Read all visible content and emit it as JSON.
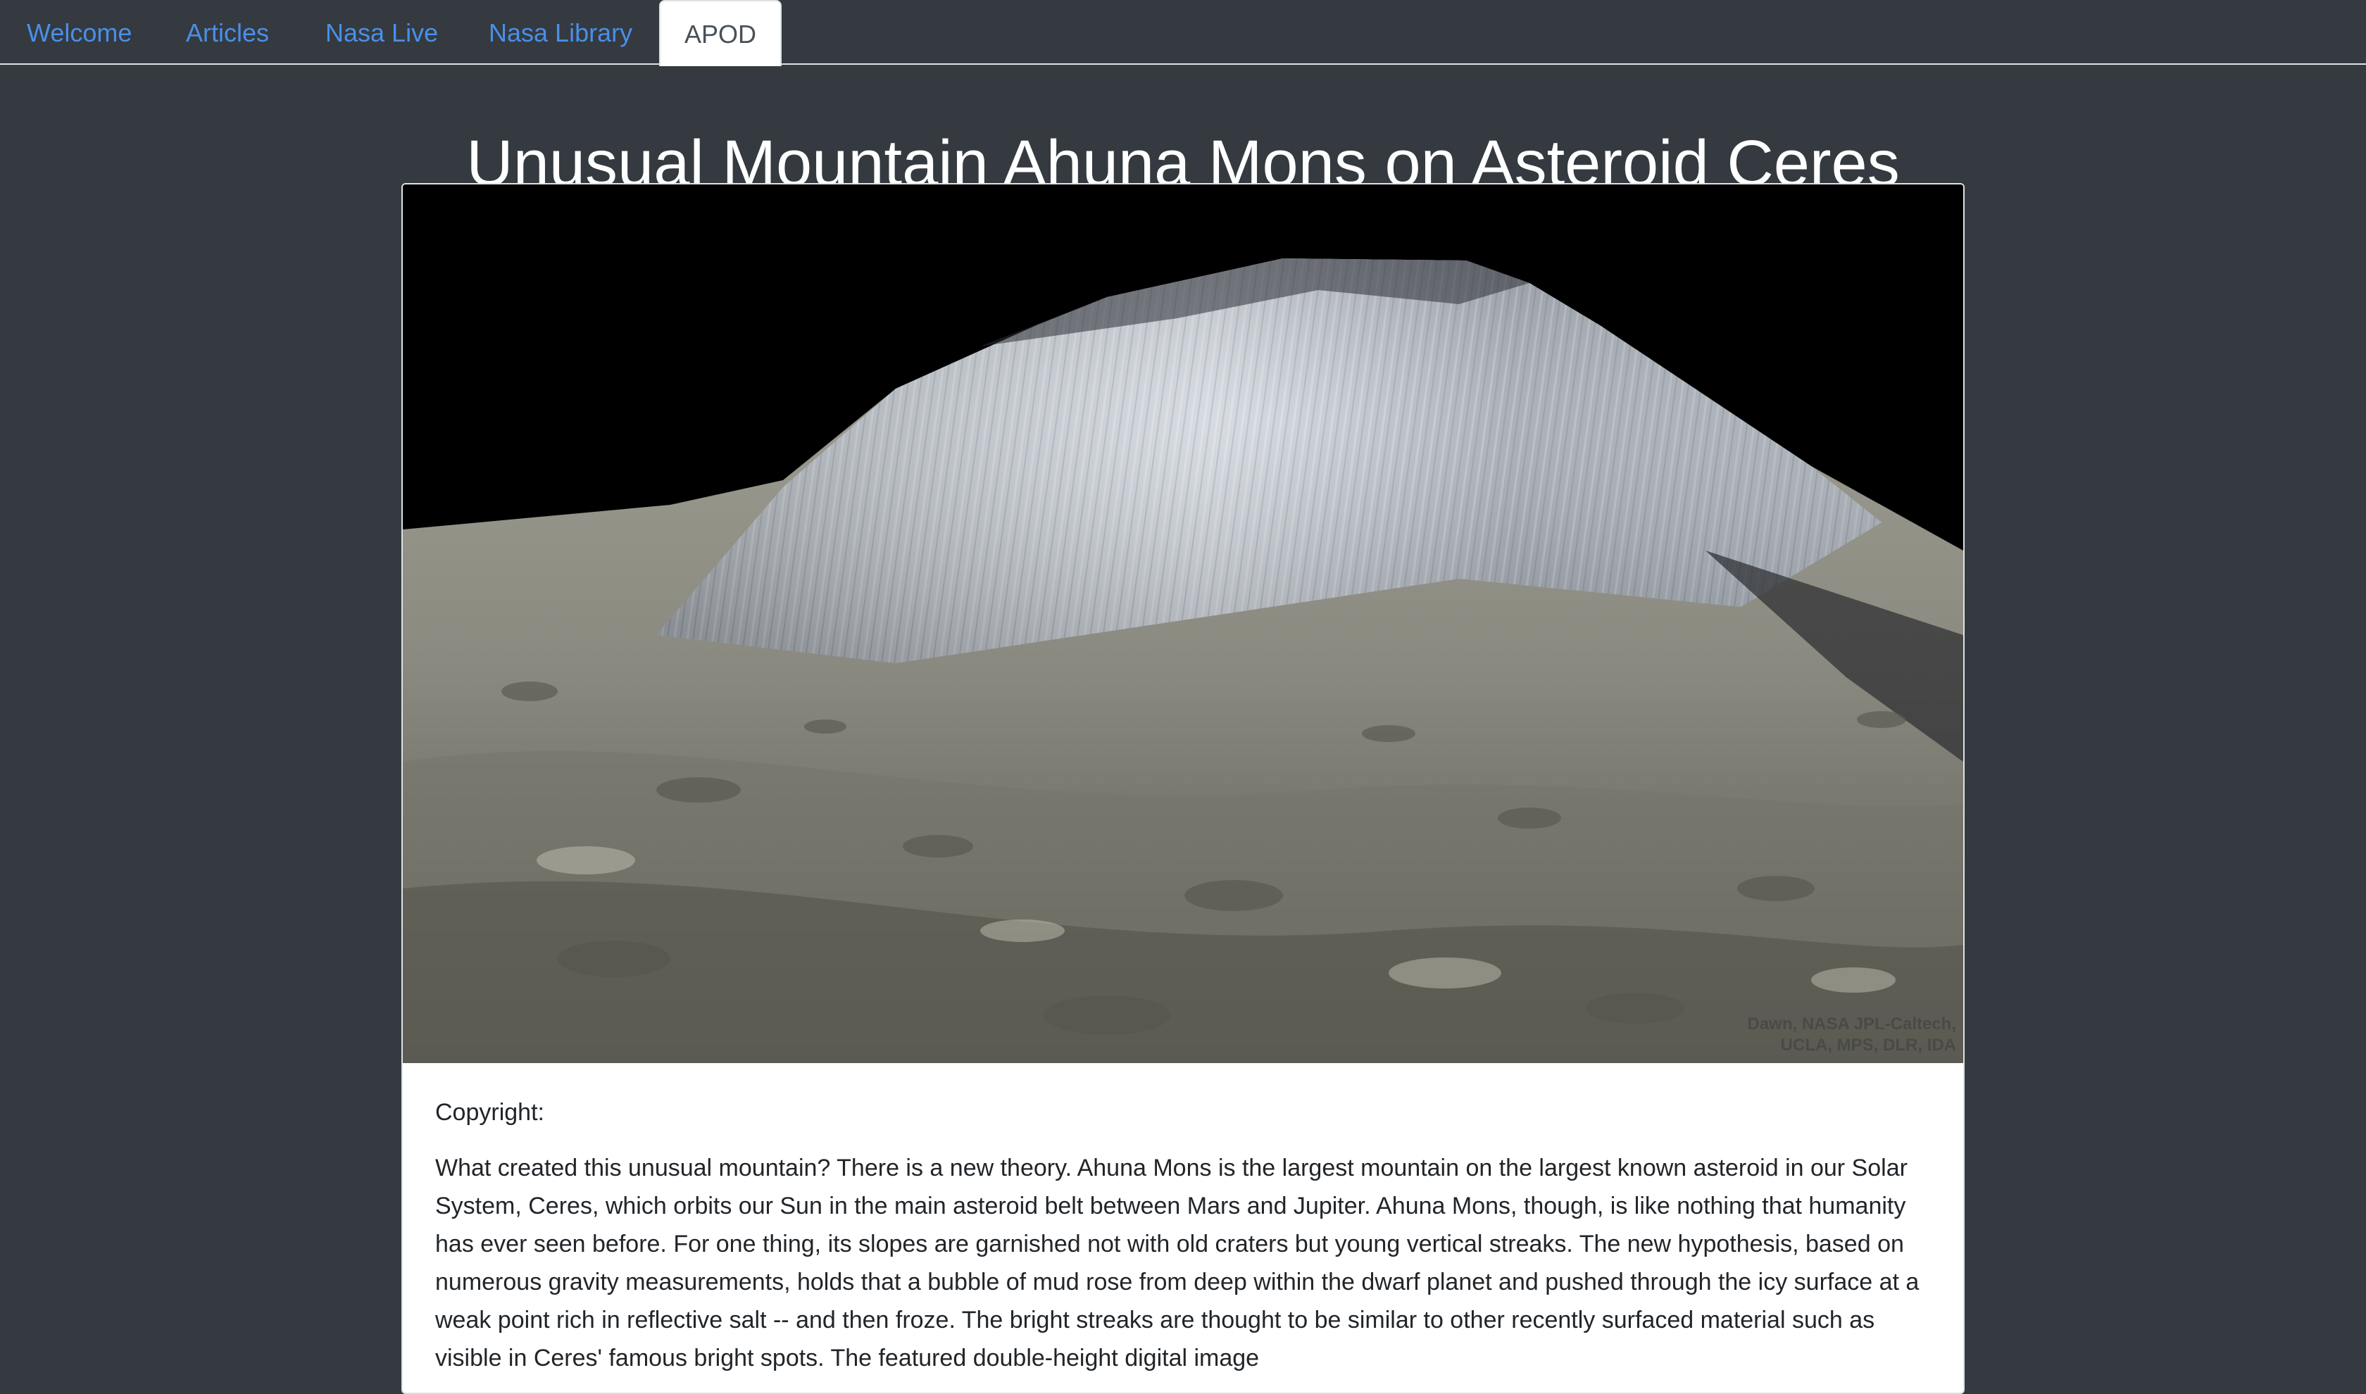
{
  "nav": {
    "tabs": [
      {
        "label": "Welcome",
        "active": false
      },
      {
        "label": "Articles",
        "active": false
      },
      {
        "label": "Nasa Live",
        "active": false
      },
      {
        "label": "Nasa Library",
        "active": false
      },
      {
        "label": "APOD",
        "active": true
      }
    ]
  },
  "apod": {
    "title": "Unusual Mountain Ahuna Mons on Asteroid Ceres",
    "image_credit_line1": "Dawn, NASA JPL-Caltech,",
    "image_credit_line2": "UCLA, MPS, DLR, IDA",
    "copyright_label": "Copyright:",
    "explanation": "What created this unusual mountain? There is a new theory. Ahuna Mons is the largest mountain on the largest known asteroid in our Solar System, Ceres, which orbits our Sun in the main asteroid belt between Mars and Jupiter. Ahuna Mons, though, is like nothing that humanity has ever seen before. For one thing, its slopes are garnished not with old craters but young vertical streaks. The new hypothesis, based on numerous gravity measurements, holds that a bubble of mud rose from deep within the dwarf planet and pushed through the icy surface at a weak point rich in reflective salt -- and then froze. The bright streaks are thought to be similar to other recently surfaced material such as visible in Ceres' famous bright spots. The featured double-height digital image"
  },
  "colors": {
    "page_background": "#343a40",
    "link": "#4a8fe8",
    "active_tab_text": "#495057"
  }
}
